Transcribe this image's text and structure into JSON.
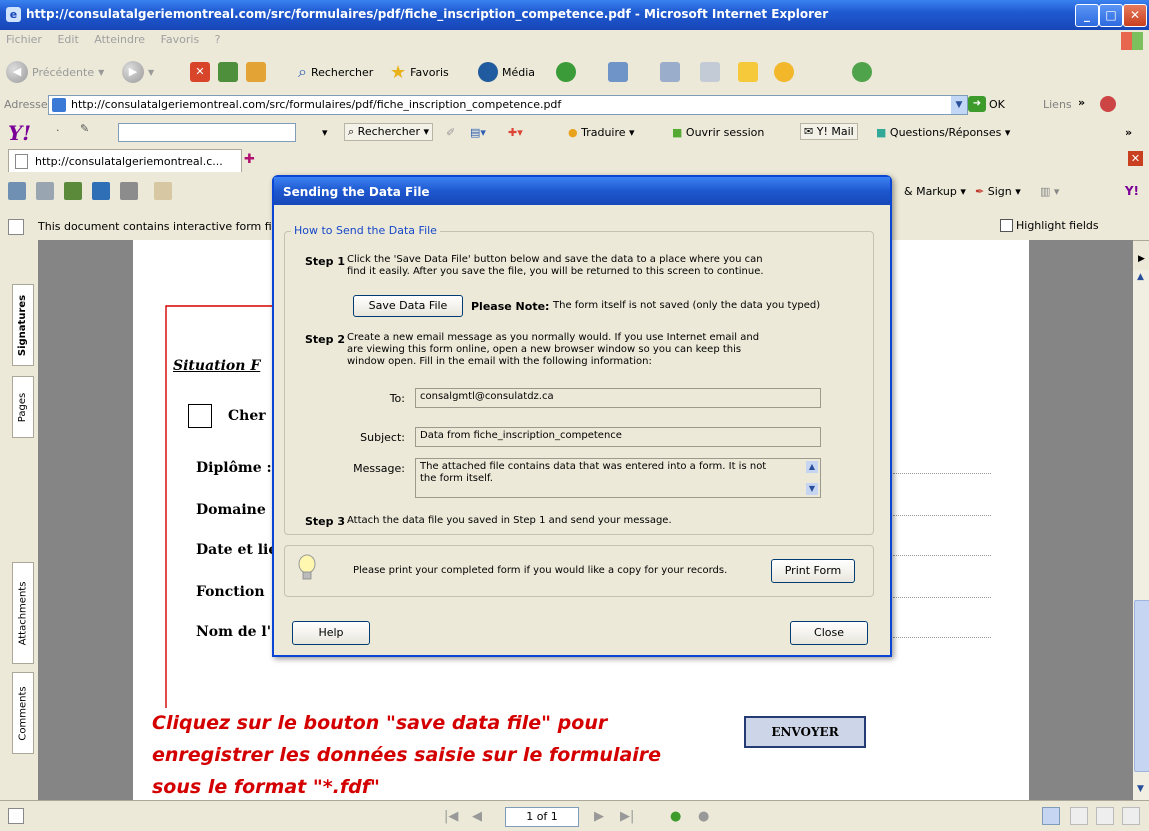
{
  "browser": {
    "title": "http://consulatalgeriemontreal.com/src/formulaires/pdf/fiche_inscription_competence.pdf - Microsoft Internet Explorer",
    "menu": [
      "Fichier",
      "Edit",
      "Atteindre",
      "Favoris",
      "?"
    ],
    "toolbar": {
      "back": "Précédente",
      "search": "Rechercher",
      "favorites": "Favoris",
      "media": "Média"
    },
    "address": {
      "label": "Adresse",
      "url": "http://consulatalgeriemontreal.com/src/formulaires/pdf/fiche_inscription_competence.pdf",
      "go": "OK",
      "links": "Liens"
    },
    "yahoo": {
      "logo": "Y!",
      "search": "Rechercher",
      "translate": "Traduire",
      "session": "Ouvrir session",
      "mail": "Y! Mail",
      "answers": "Questions/Réponses"
    },
    "tab": {
      "label": "http://consulatalgeriemontreal.c..."
    }
  },
  "pdf": {
    "toolbar_right": {
      "markup": "& Markup",
      "sign": "Sign",
      "yahoo": "Y!"
    },
    "message": "This document contains interactive form fie",
    "highlight": "Highlight fields",
    "side_tabs": [
      "Signatures",
      "Pages",
      "Attachments",
      "Comments"
    ],
    "page_indicator": "1 of 1"
  },
  "form": {
    "section_title": "Situation F",
    "checkbox_label": "Cher",
    "fields": [
      "Diplôme :",
      "Domaine",
      "Date et lie",
      "Fonction",
      "Nom de l'"
    ],
    "send_button": "ENVOYER"
  },
  "annotation": {
    "lines": [
      "Cliquez sur le bouton \"save data file\" pour",
      "enregistrer les données saisie sur le formulaire",
      "sous le format \"*.fdf\""
    ],
    "color": "#d40000"
  },
  "dialog": {
    "title": "Sending the Data File",
    "group_title": "How to Send the Data File",
    "step1_label": "Step 1",
    "step1_line1": "Click the 'Save Data File' button below and save the data to a place where you can",
    "step1_line2": "find it easily. After you save the file, you will be returned to this screen to continue.",
    "save_button": "Save Data File",
    "please_note": "Please Note:",
    "note_text": "The form itself is not saved (only the data you typed)",
    "step2_label": "Step 2",
    "step2_line1": "Create a new email message as you normally would.  If you use Internet email and",
    "step2_line2": "are viewing this form online, open a new browser window so you can keep this",
    "step2_line3": "window open. Fill in the email with the following information:",
    "to_label": "To:",
    "to_value": "consalgmtl@consulatdz.ca",
    "subject_label": "Subject:",
    "subject_value": "Data from fiche_inscription_competence",
    "message_label": "Message:",
    "message_line1": "The attached file contains data that was entered into a form. It is not",
    "message_line2": "the form itself.",
    "step3_label": "Step 3",
    "step3_text": "Attach the data file you saved in Step 1 and send your message.",
    "print_text": "Please print your completed form if you would like a copy for your records.",
    "print_button": "Print Form",
    "help_button": "Help",
    "close_button": "Close"
  }
}
